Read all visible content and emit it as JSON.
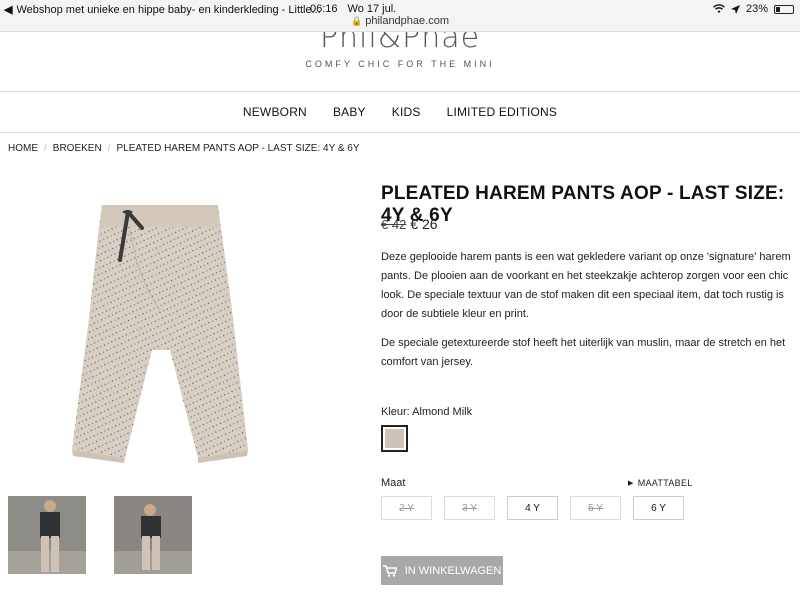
{
  "statusbar": {
    "back_icon": "back-arrow-icon",
    "tab_title": "Webshop met unieke en hippe baby- en kinderkleding - Little...",
    "time": "06:16",
    "date": "Wo 17 jul.",
    "url": "philandphae.com",
    "battery_pct": "23%",
    "battery_level": 0.23
  },
  "header": {
    "logo": "Phil&Phae",
    "tagline": "COMFY CHIC FOR THE MINI"
  },
  "nav": {
    "items": [
      "NEWBORN",
      "BABY",
      "KIDS",
      "LIMITED EDITIONS"
    ]
  },
  "breadcrumb": [
    "HOME",
    "BROEKEN",
    "PLEATED HAREM PANTS AOP - LAST SIZE: 4Y & 6Y"
  ],
  "product": {
    "title": "PLEATED HAREM PANTS AOP - LAST SIZE: 4Y & 6Y",
    "old_price": "€ 42",
    "new_price": "€ 26",
    "description": [
      "Deze geplooide harem pants is een wat gekledere variant op onze 'signature' harem pants. De plooien aan de voorkant en het steekzakje achterop zorgen voor een chic look. De speciale textuur van de stof maken dit een speciaal item, dat toch rustig is door de subtiele kleur en print.",
      "De speciale getextureerde stof heeft het uiterlijk van muslin, maar de stretch en het comfort van jersey."
    ],
    "color_label": "Kleur: Almond Milk",
    "color_hex": "#cfc3b7",
    "size_label": "Maat",
    "size_table_label": "MAATTABEL",
    "sizes": [
      {
        "label": "2 Y",
        "available": false
      },
      {
        "label": "3 Y",
        "available": false
      },
      {
        "label": "4 Y",
        "available": true
      },
      {
        "label": "5 Y",
        "available": false
      },
      {
        "label": "6 Y",
        "available": true
      }
    ],
    "cart_label": "IN WINKELWAGEN"
  }
}
